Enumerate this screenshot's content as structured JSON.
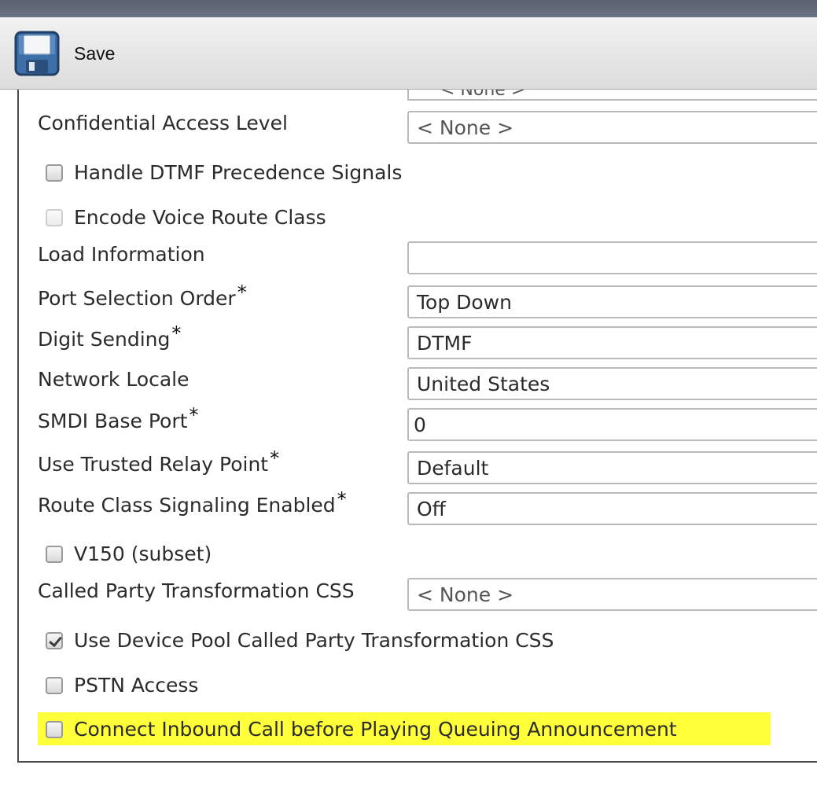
{
  "toolbar": {
    "save_label": "Save"
  },
  "top_cut_value": "< None >",
  "rows": {
    "confidential_access_level": {
      "label": "Confidential Access Level",
      "value": "< None >"
    },
    "handle_dtmf": {
      "label": "Handle DTMF Precedence Signals",
      "checked": false
    },
    "encode_voice_route": {
      "label": "Encode Voice Route Class",
      "checked": false,
      "disabled": true
    },
    "load_information": {
      "label": "Load Information",
      "value": ""
    },
    "port_selection_order": {
      "label": "Port Selection Order",
      "required": "*",
      "value": "Top Down"
    },
    "digit_sending": {
      "label": "Digit Sending",
      "required": "*",
      "value": "DTMF"
    },
    "network_locale": {
      "label": "Network Locale",
      "value": "United States"
    },
    "smdi_base_port": {
      "label": "SMDI Base Port",
      "required": "*",
      "value": "0"
    },
    "use_trusted_relay_point": {
      "label": "Use Trusted Relay Point",
      "required": "*",
      "value": "Default"
    },
    "route_class_signaling": {
      "label": "Route Class Signaling Enabled",
      "required": "*",
      "value": "Off"
    },
    "v150": {
      "label": "V150 (subset)",
      "checked": false
    },
    "called_party_css": {
      "label": "Called Party Transformation CSS",
      "value": "< None >"
    },
    "use_device_pool_css": {
      "label": "Use Device Pool Called Party Transformation CSS",
      "checked": true
    },
    "pstn_access": {
      "label": "PSTN Access",
      "checked": false
    },
    "connect_inbound": {
      "label": "Connect Inbound Call before Playing Queuing Announcement",
      "checked": false,
      "highlighted": true
    }
  },
  "colors": {
    "highlight": "#ffff3a",
    "title_bar": "#5a6272"
  }
}
